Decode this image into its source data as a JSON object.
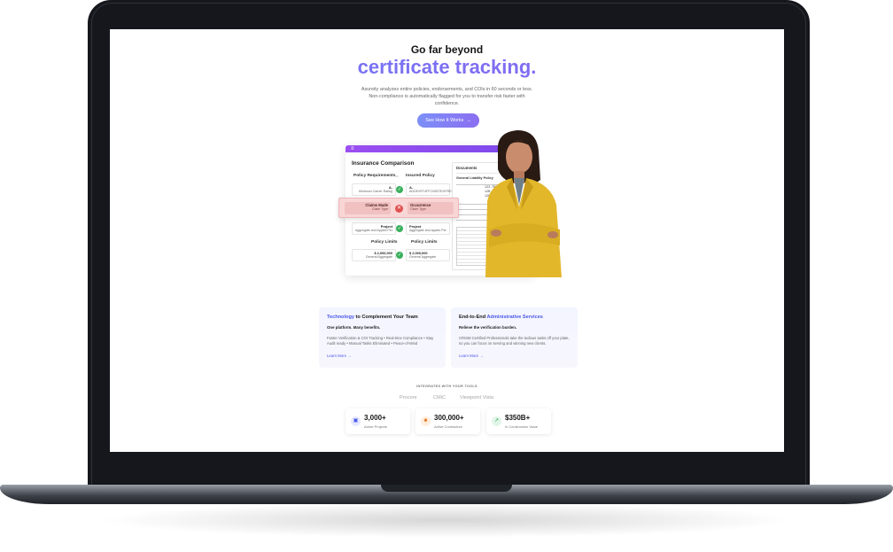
{
  "hero": {
    "eyebrow": "Go far beyond",
    "headline": "certificate tracking.",
    "subtext": "Asureity analyzes entire policies, endorsements, and COIs in 60 seconds or less. Non-compliance is automatically flagged for you to transfer risk faster with confidence.",
    "cta_label": "See How It Works",
    "cta_arrow": "→"
  },
  "mockup": {
    "menu_icon": "≡",
    "title": "Insurance Comparison",
    "col_left": "Policy Requirements",
    "vs": "vs",
    "col_right": "Insured Policy",
    "rows": [
      {
        "left_title": "A-",
        "left_sub": "Minimum Carrier Rating",
        "right_title": "A-",
        "right_sub": "ADDEVRT4FFCNS5TEGFREE",
        "status": "check"
      },
      {
        "left_title": "Project",
        "left_sub": "Aggregate and Appies Per",
        "right_title": "Project",
        "right_sub": "Aggregate and appies Per",
        "status": "check"
      },
      {
        "left_title": "$ 2,000,000",
        "left_sub": "General Aggregate",
        "right_title": "$ 2,000,000",
        "right_sub": "General Aggregate",
        "status": "check"
      }
    ],
    "limits_left": "Policy Limits",
    "limits_right": "Policy Limits",
    "highlight": {
      "left_title": "Claims Made",
      "left_sub": "Claim Type",
      "right_title": "Occurrence",
      "right_sub": "Claim Type",
      "icon": "✕"
    },
    "documents": {
      "title": "Documents",
      "subtitle": "General Liability Policy",
      "code_1": "123.7NE71",
      "code_2": "12B-TNCI225-35",
      "code_3": "12B-TNCI225-35"
    },
    "check_glyph": "✓"
  },
  "cards": [
    {
      "title_highlight": "Technology",
      "title_rest": " to Complement Your Team",
      "lead": "One platform. Many benefits.",
      "body": "Faster Verification & COI Tracking • Real-time Compliance • Stay Audit ready • Manual Tasks Eliminated • Peace-of-Mind",
      "link": "Learn More →"
    },
    {
      "title_plain": "End-to-End ",
      "title_highlight": "Administrative Services",
      "lead": "Relieve the verification burden.",
      "body": "CRISM Certified Professionals take the tedious tasks off your plate, so you can focus on serving and winning new clients.",
      "link": "Learn More →"
    }
  ],
  "integrations": {
    "label": "INTEGRATES WITH YOUR TOOLS",
    "tools": [
      "Procore",
      "CMiC",
      "Viewpoint Vista"
    ]
  },
  "stats": [
    {
      "value": "3,000+",
      "label": "Active Projects",
      "icon": "building-icon",
      "glyph": "▣",
      "color": "#4a57e8",
      "bg": "#e6e9ff"
    },
    {
      "value": "300,000+",
      "label": "Active Contractors",
      "icon": "people-icon",
      "glyph": "☻",
      "color": "#e07b2a",
      "bg": "#ffeede"
    },
    {
      "value": "$350B+",
      "label": "In Construction Value",
      "icon": "trend-icon",
      "glyph": "↗",
      "color": "#2f9e55",
      "bg": "#e2f6e8"
    }
  ]
}
